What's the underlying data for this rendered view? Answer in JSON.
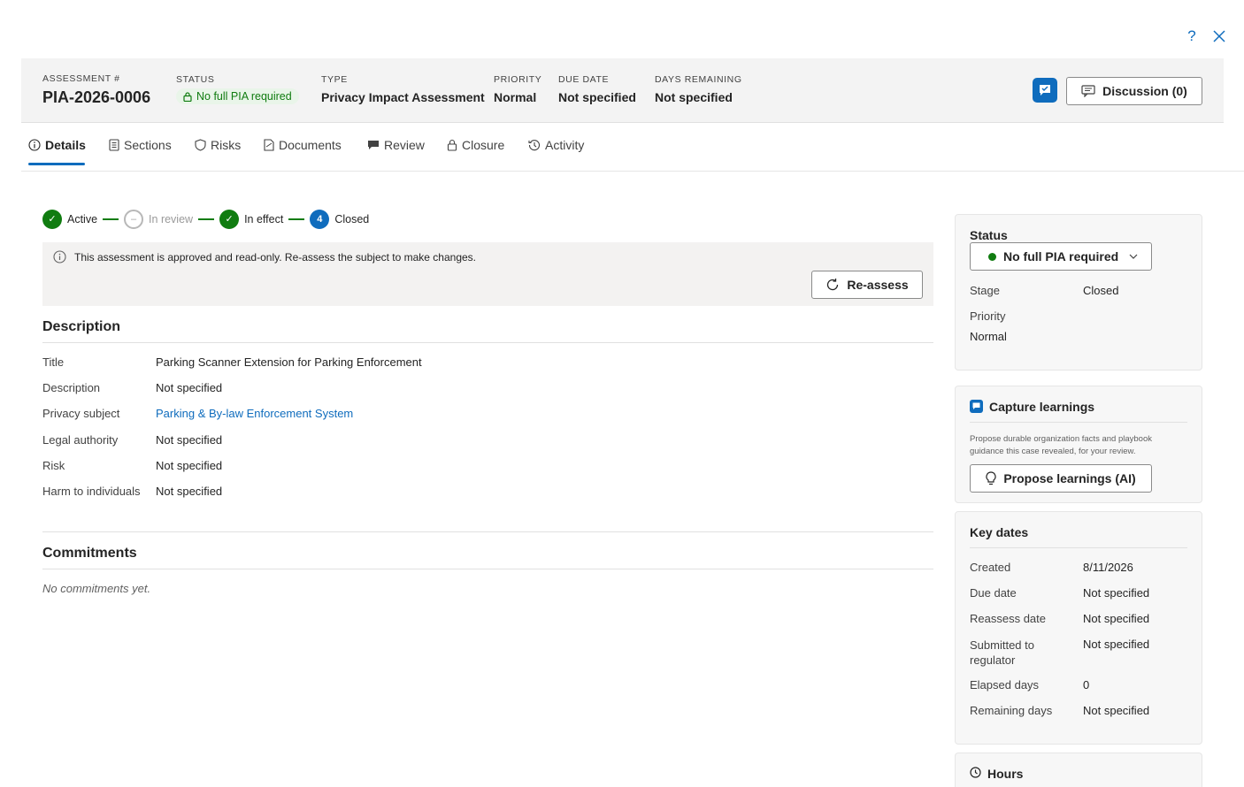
{
  "chrome": {
    "help_label": "?",
    "close_label": "×"
  },
  "header": {
    "assessment_label": "ASSESSMENT #",
    "assessment_id": "PIA-2026-0006",
    "status_label": "STATUS",
    "status_value": "No full PIA required",
    "type_label": "TYPE",
    "type_value": "Privacy Impact Assessment",
    "priority_label": "PRIORITY",
    "priority_value": "Normal",
    "due_label": "DUE DATE",
    "due_value": "Not specified",
    "days_label": "DAYS REMAINING",
    "days_value": "Not specified",
    "discussion_label": "Discussion (0)"
  },
  "tabs": [
    {
      "label": "Details",
      "icon": "info-icon"
    },
    {
      "label": "Sections",
      "icon": "sections-icon"
    },
    {
      "label": "Risks",
      "icon": "shield-icon"
    },
    {
      "label": "Documents",
      "icon": "document-icon"
    },
    {
      "label": "Review",
      "icon": "review-icon"
    },
    {
      "label": "Closure",
      "icon": "lock-icon"
    },
    {
      "label": "Activity",
      "icon": "history-icon"
    }
  ],
  "stepper": [
    {
      "label": "Active",
      "state": "done",
      "mark": "✓"
    },
    {
      "label": "In review",
      "state": "pending",
      "mark": "–"
    },
    {
      "label": "In effect",
      "state": "done",
      "mark": "✓"
    },
    {
      "label": "Closed",
      "state": "current",
      "mark": "4"
    }
  ],
  "banner": {
    "text": "This assessment is approved and read-only. Re-assess the subject to make changes.",
    "reassess_label": "Re-assess"
  },
  "description": {
    "heading": "Description",
    "rows": [
      {
        "label": "Title",
        "value": "Parking Scanner Extension for Parking Enforcement"
      },
      {
        "label": "Description",
        "value": "Not specified"
      },
      {
        "label": "Privacy subject",
        "value": "Parking & By-law Enforcement System"
      },
      {
        "label": "Legal authority",
        "value": "Not specified"
      },
      {
        "label": "Risk",
        "value": "Not specified"
      },
      {
        "label": "Harm to individuals",
        "value": "Not specified"
      }
    ]
  },
  "commitments": {
    "heading": "Commitments",
    "empty": "No commitments yet."
  },
  "status_card": {
    "title": "Status",
    "select_value": "No full PIA required",
    "stage_label": "Stage",
    "stage_value": "Closed",
    "priority_label": "Priority",
    "priority_value": "Normal"
  },
  "learnings_card": {
    "title": "Capture learnings",
    "hint": "Propose durable organization facts and playbook guidance this case revealed, for your review.",
    "button_label": "Propose learnings (AI)"
  },
  "dates_card": {
    "title": "Key dates",
    "rows": [
      {
        "label": "Created",
        "value": "8/11/2026"
      },
      {
        "label": "Due date",
        "value": "Not specified"
      },
      {
        "label": "Reassess date",
        "value": "Not specified"
      },
      {
        "label": "Submitted to regulator",
        "value": "Not specified"
      },
      {
        "label": "Elapsed days",
        "value": "0"
      },
      {
        "label": "Remaining days",
        "value": "Not specified"
      }
    ]
  },
  "hours_card": {
    "title": "Hours"
  },
  "colors": {
    "accent": "#0f6cbd",
    "success": "#107c10",
    "header_bg": "#f3f3f3"
  }
}
